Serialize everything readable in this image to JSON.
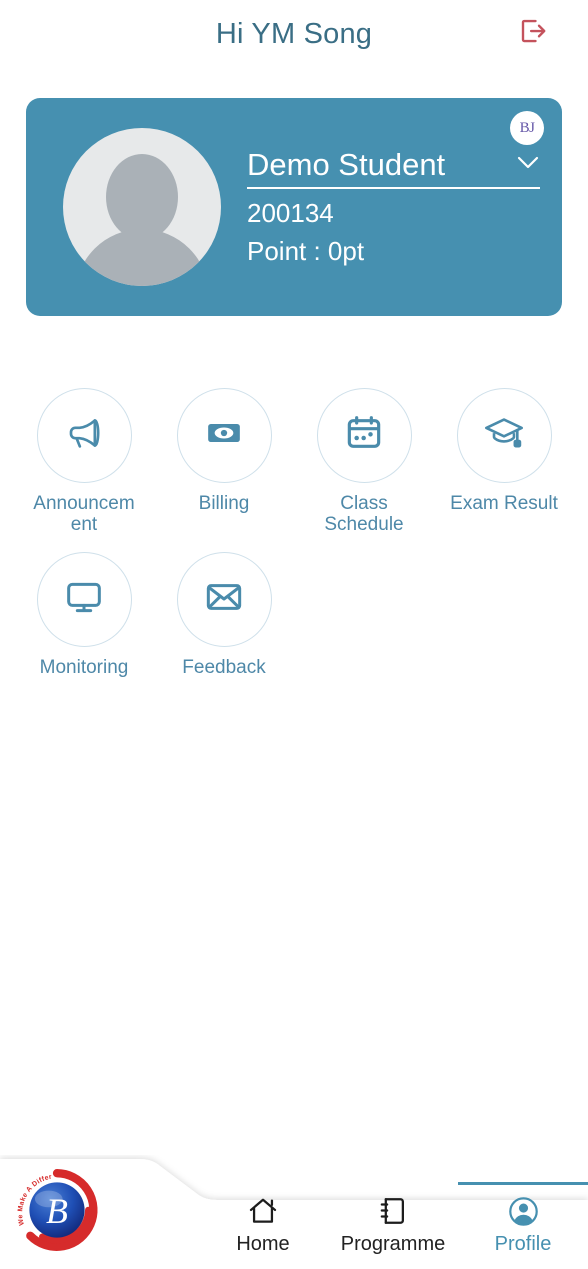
{
  "header": {
    "greeting": "Hi YM Song",
    "logout_icon": "logout-icon",
    "logout_color": "#c4525c"
  },
  "profile_card": {
    "badge_text": "BJ",
    "badge_color": "#6557a8",
    "card_color": "#4690b0",
    "avatar_icon": "avatar-placeholder-icon",
    "student_name": "Demo Student",
    "student_id": "200134",
    "point_label": "Point : 0pt",
    "chevron_icon": "chevron-down-icon"
  },
  "menu": {
    "items": [
      {
        "label": "Announcement",
        "icon": "megaphone-icon"
      },
      {
        "label": "Billing",
        "icon": "banknote-icon"
      },
      {
        "label": "Class Schedule",
        "icon": "calendar-icon"
      },
      {
        "label": "Exam Result",
        "icon": "graduation-cap-icon"
      },
      {
        "label": "Monitoring",
        "icon": "monitor-icon"
      },
      {
        "label": "Feedback",
        "icon": "envelope-icon"
      }
    ],
    "label_color": "#4e88a8",
    "circle_border_color": "#cfe0ea"
  },
  "bottom_nav": {
    "logo": {
      "letter": "B",
      "tagline": "We Make A Difference",
      "icon": "brand-logo-icon"
    },
    "items": [
      {
        "label": "Home",
        "icon": "home-icon",
        "active": false
      },
      {
        "label": "Programme",
        "icon": "notebook-icon",
        "active": false
      },
      {
        "label": "Profile",
        "icon": "person-circle-icon",
        "active": true
      }
    ],
    "active_color": "#4690b0"
  }
}
